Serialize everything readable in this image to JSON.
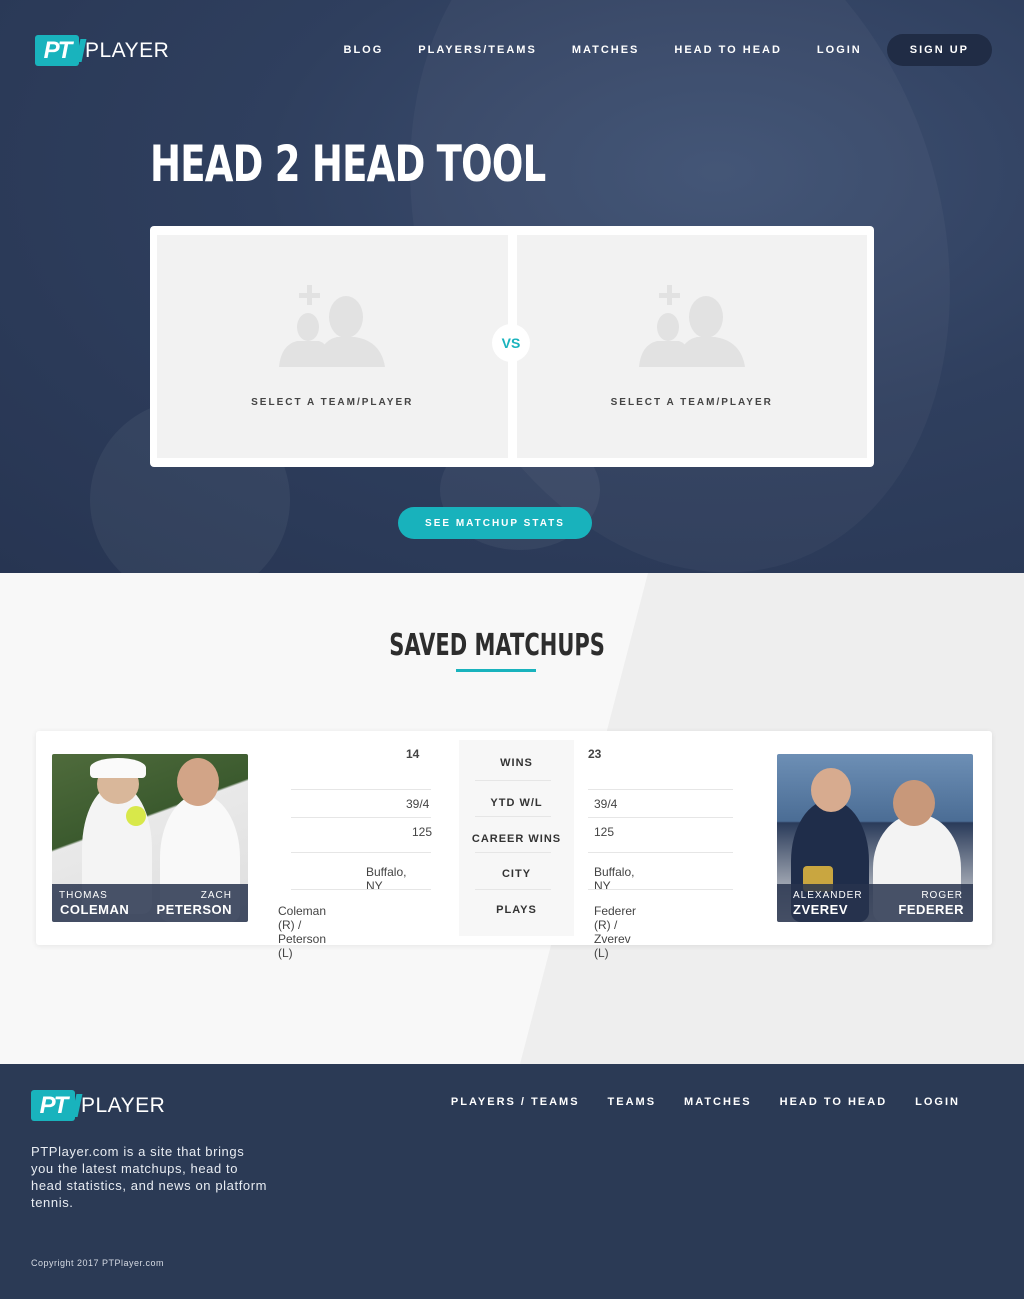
{
  "brand": {
    "badge": "PT",
    "name": "PLAYER",
    "accent": "#19b3bd"
  },
  "nav": {
    "items": [
      "BLOG",
      "PLAYERS/TEAMS",
      "MATCHES",
      "HEAD TO HEAD",
      "LOGIN"
    ],
    "signup": "SIGN UP"
  },
  "hero": {
    "title": "HEAD 2 HEAD TOOL",
    "slot_left_label": "SELECT A TEAM/PLAYER",
    "slot_right_label": "SELECT A TEAM/PLAYER",
    "vs": "VS",
    "cta": "SEE MATCHUP STATS"
  },
  "saved": {
    "title": "SAVED MATCHUPS",
    "labels": [
      "WINS",
      "YTD W/L",
      "CAREER WINS",
      "CITY",
      "PLAYS"
    ],
    "left": {
      "player1_first": "THOMAS",
      "player1_last": "COLEMAN",
      "player2_first": "ZACH",
      "player2_last": "PETERSON",
      "wins": "14",
      "ytd": "39/4",
      "career": "125",
      "city": "Buffalo, NY",
      "plays": "Coleman (R) / Peterson (L)"
    },
    "right": {
      "player1_first": "ALEXANDER",
      "player1_last": "ZVEREV",
      "player2_first": "ROGER",
      "player2_last": "FEDERER",
      "wins": "23",
      "ytd": "39/4",
      "career": "125",
      "city": "Buffalo, NY",
      "plays": "Federer (R) / Zverev (L)"
    }
  },
  "footer": {
    "nav": [
      "PLAYERS / TEAMS",
      "TEAMS",
      "MATCHES",
      "HEAD TO HEAD",
      "LOGIN"
    ],
    "description": "PTPlayer.com is a site that brings you the latest matchups, head to head statistics, and news on platform tennis.",
    "copyright": "Copyright 2017 PTPlayer.com"
  }
}
